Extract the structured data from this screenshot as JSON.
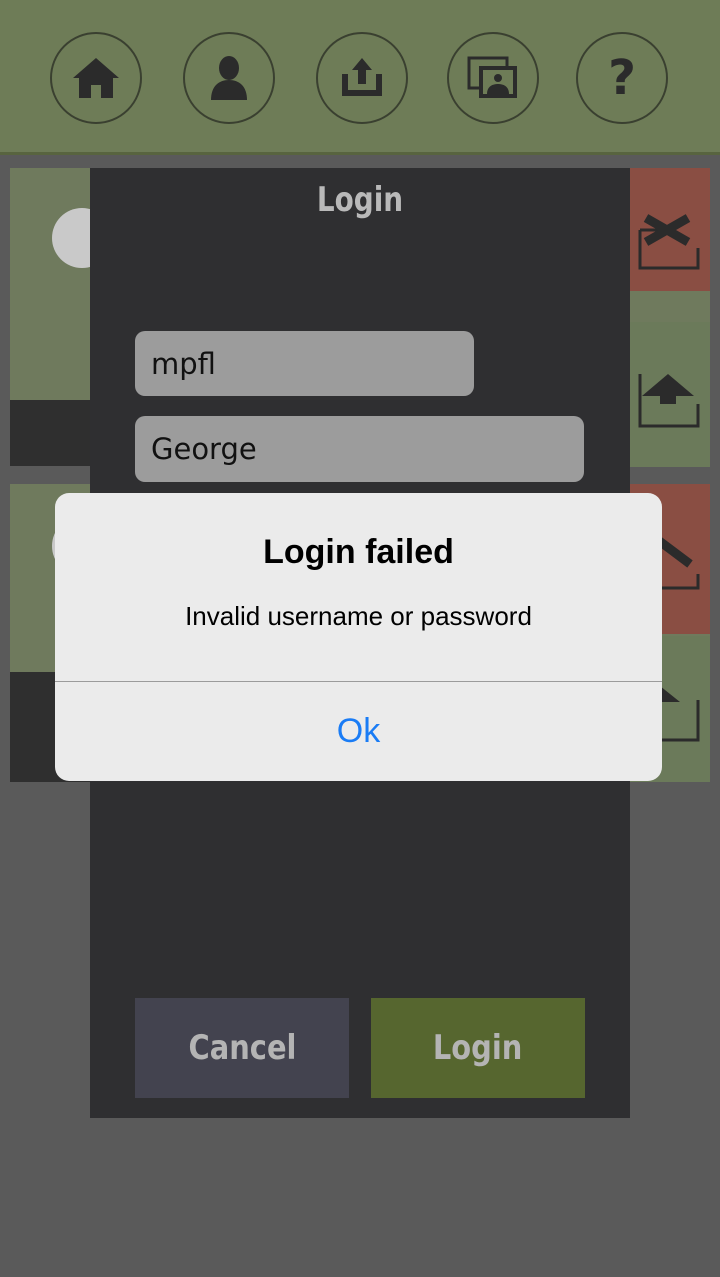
{
  "nav": {
    "items": [
      {
        "icon": "home-icon"
      },
      {
        "icon": "user-icon"
      },
      {
        "icon": "upload-icon"
      },
      {
        "icon": "gallery-icon"
      },
      {
        "icon": "help-icon",
        "glyph": "?"
      }
    ]
  },
  "login": {
    "title": "Login",
    "username_value": "mpfl",
    "password_value": "George",
    "cancel_label": "Cancel",
    "login_label": "Login"
  },
  "alert": {
    "title": "Login failed",
    "message": "Invalid username or password",
    "ok_label": "Ok"
  },
  "colors": {
    "topbar": "#6e7c57",
    "dialog": "#2f2f31",
    "login_button": "#56662f",
    "cancel_button": "#43434f",
    "alert_link": "#1a7cf5",
    "tile_red": "#8a4e43",
    "tile_green": "#6b7a5a"
  }
}
